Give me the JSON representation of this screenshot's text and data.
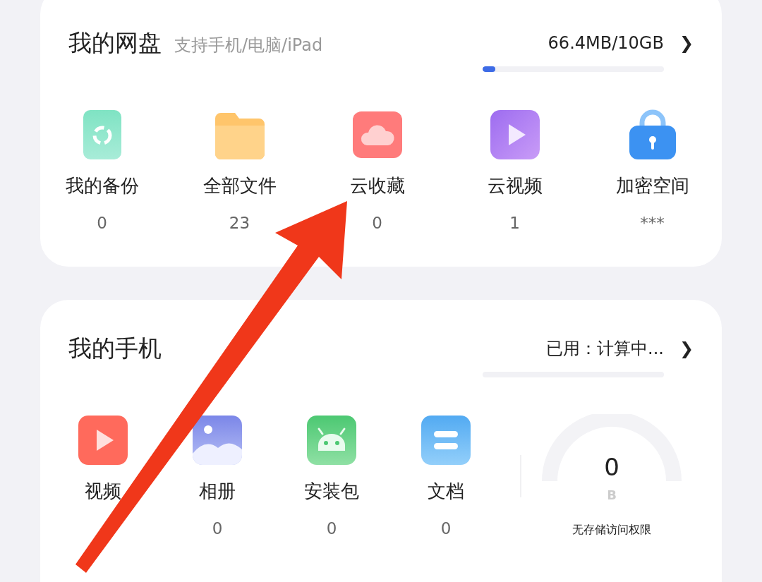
{
  "cloud_card": {
    "title": "我的网盘",
    "subtitle": "支持手机/电脑/iPad",
    "usage": "66.4MB/10GB",
    "chevron": "❯",
    "level": 0.07,
    "items": [
      {
        "kind": "backup",
        "label": "我的备份",
        "count": "0"
      },
      {
        "kind": "folder",
        "label": "全部文件",
        "count": "23"
      },
      {
        "kind": "cloud",
        "label": "云收藏",
        "count": "0"
      },
      {
        "kind": "video",
        "label": "云视频",
        "count": "1"
      },
      {
        "kind": "lock",
        "label": "加密空间",
        "count": "***"
      }
    ]
  },
  "phone_card": {
    "title": "我的手机",
    "usage": "已用：计算中...",
    "chevron": "❯",
    "level": 0,
    "items": [
      {
        "kind": "play",
        "label": "视频"
      },
      {
        "kind": "photo",
        "label": "相册",
        "count": "0"
      },
      {
        "kind": "android",
        "label": "安装包",
        "count": "0"
      },
      {
        "kind": "doc",
        "label": "文档",
        "count": "0"
      }
    ],
    "gauge": {
      "value": "0",
      "unit": "B",
      "note": "无存储访问权限"
    }
  }
}
